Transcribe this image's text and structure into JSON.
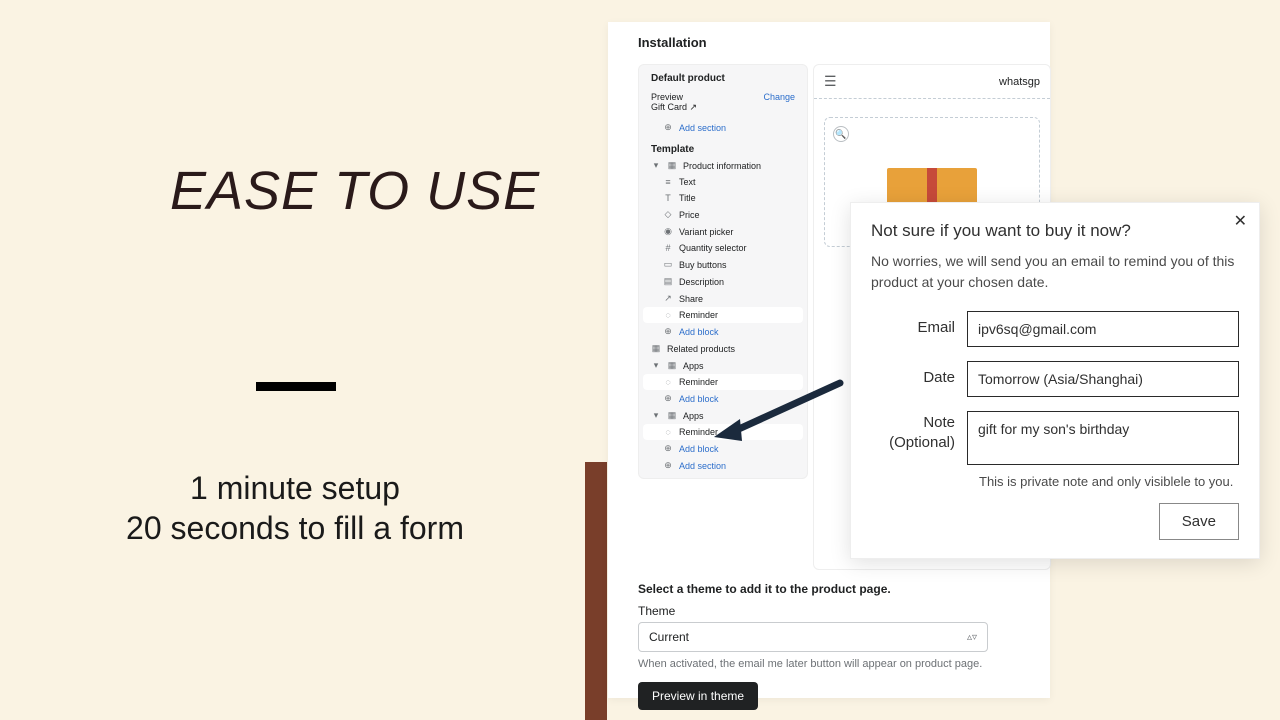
{
  "marketing": {
    "headline": "EASE TO USE",
    "sub1": "1 minute setup",
    "sub2": "20 seconds to fill a form"
  },
  "shot": {
    "title": "Installation",
    "tree": {
      "default_product": "Default product",
      "preview_label": "Preview",
      "change": "Change",
      "gift_card": "Gift Card  ↗",
      "add_section": "Add section",
      "template": "Template",
      "product_info": "Product information",
      "items": {
        "text": "Text",
        "title": "Title",
        "price": "Price",
        "variant": "Variant picker",
        "qty": "Quantity selector",
        "buy": "Buy buttons",
        "desc": "Description",
        "share": "Share",
        "reminder": "Reminder"
      },
      "add_block": "Add block",
      "related": "Related products",
      "apps": "Apps"
    },
    "preview": {
      "brand": "whatsgp"
    },
    "bottom": {
      "select_theme": "Select a theme to add it to the product page.",
      "theme_label": "Theme",
      "theme_value": "Current",
      "hint": "When activated, the email me later button will appear on product page.",
      "preview_btn": "Preview in theme"
    }
  },
  "modal": {
    "title": "Not sure if you want to buy it now?",
    "body": "No worries, we will send you an email to remind you of this product at your chosen date.",
    "email_label": "Email",
    "email_value": "ipv6sq@gmail.com",
    "date_label": "Date",
    "date_value": "Tomorrow  (Asia/Shanghai)",
    "note_label1": "Note",
    "note_label2": "(Optional)",
    "note_value": "gift for my son's birthday",
    "priv": "This is private note and only visiblele to you.",
    "save": "Save"
  }
}
